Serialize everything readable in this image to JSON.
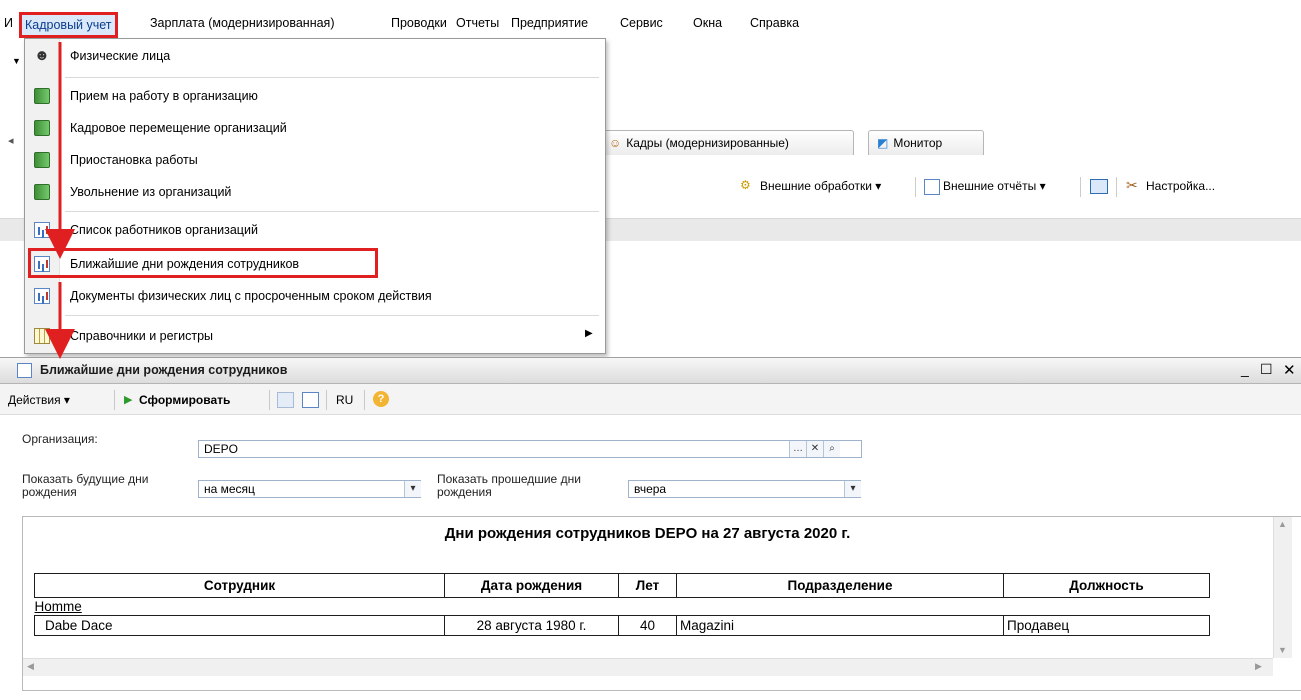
{
  "menubar": {
    "left_fragment": "И",
    "active": "Кадровый учет",
    "items": [
      "Зарплата (модернизированная)",
      "Проводки",
      "Отчеты",
      "Предприятие",
      "Сервис",
      "Окна",
      "Справка"
    ]
  },
  "dropdown": {
    "items": [
      {
        "label": "Физические лица",
        "icon": "person-icon"
      },
      {
        "label": "Прием на работу в организацию",
        "icon": "document-icon"
      },
      {
        "label": "Кадровое перемещение организаций",
        "icon": "document-icon"
      },
      {
        "label": "Приостановка работы",
        "icon": "document-icon"
      },
      {
        "label": "Увольнение из организаций",
        "icon": "document-icon"
      },
      {
        "label": "Список работников организаций",
        "icon": "report-icon"
      },
      {
        "label": "Ближайшие дни рождения сотрудников",
        "icon": "report-icon"
      },
      {
        "label": "Документы физических лиц с просроченным сроком действия",
        "icon": "report-icon"
      },
      {
        "label": "Справочники и регистры",
        "icon": "table-icon"
      }
    ]
  },
  "background": {
    "tabs": [
      "Кадры (модернизированные)",
      "Монитор"
    ],
    "actions": [
      "Внешние обработки",
      "Внешние отчёты",
      "Настройка..."
    ]
  },
  "report_window": {
    "title": "Ближайшие дни рождения сотрудников",
    "toolbar": {
      "actions": "Действия",
      "generate": "Сформировать",
      "lang": "RU",
      "help": "?"
    },
    "form": {
      "org_label": "Организация:",
      "org_value": "DEPO",
      "future_label_1": "Показать будущие дни",
      "future_label_2": "рождения",
      "future_value": "на месяц",
      "past_label_1": "Показать прошедшие дни",
      "past_label_2": "рождения",
      "past_value": "вчера"
    },
    "report": {
      "title": "Дни рождения сотрудников DEPO на 27 августа 2020 г.",
      "columns": [
        "Сотрудник",
        "Дата рождения",
        "Лет",
        "Подразделение",
        "Должность"
      ],
      "group": "Homme",
      "rows": [
        {
          "employee": "Dabe Dace",
          "birthdate": "28 августа 1980 г.",
          "age": "40",
          "department": "Magazini",
          "position": "Продавец"
        }
      ]
    }
  },
  "colors": {
    "highlight": "#e02020",
    "menu_active_bg": "#dbe8f9"
  }
}
